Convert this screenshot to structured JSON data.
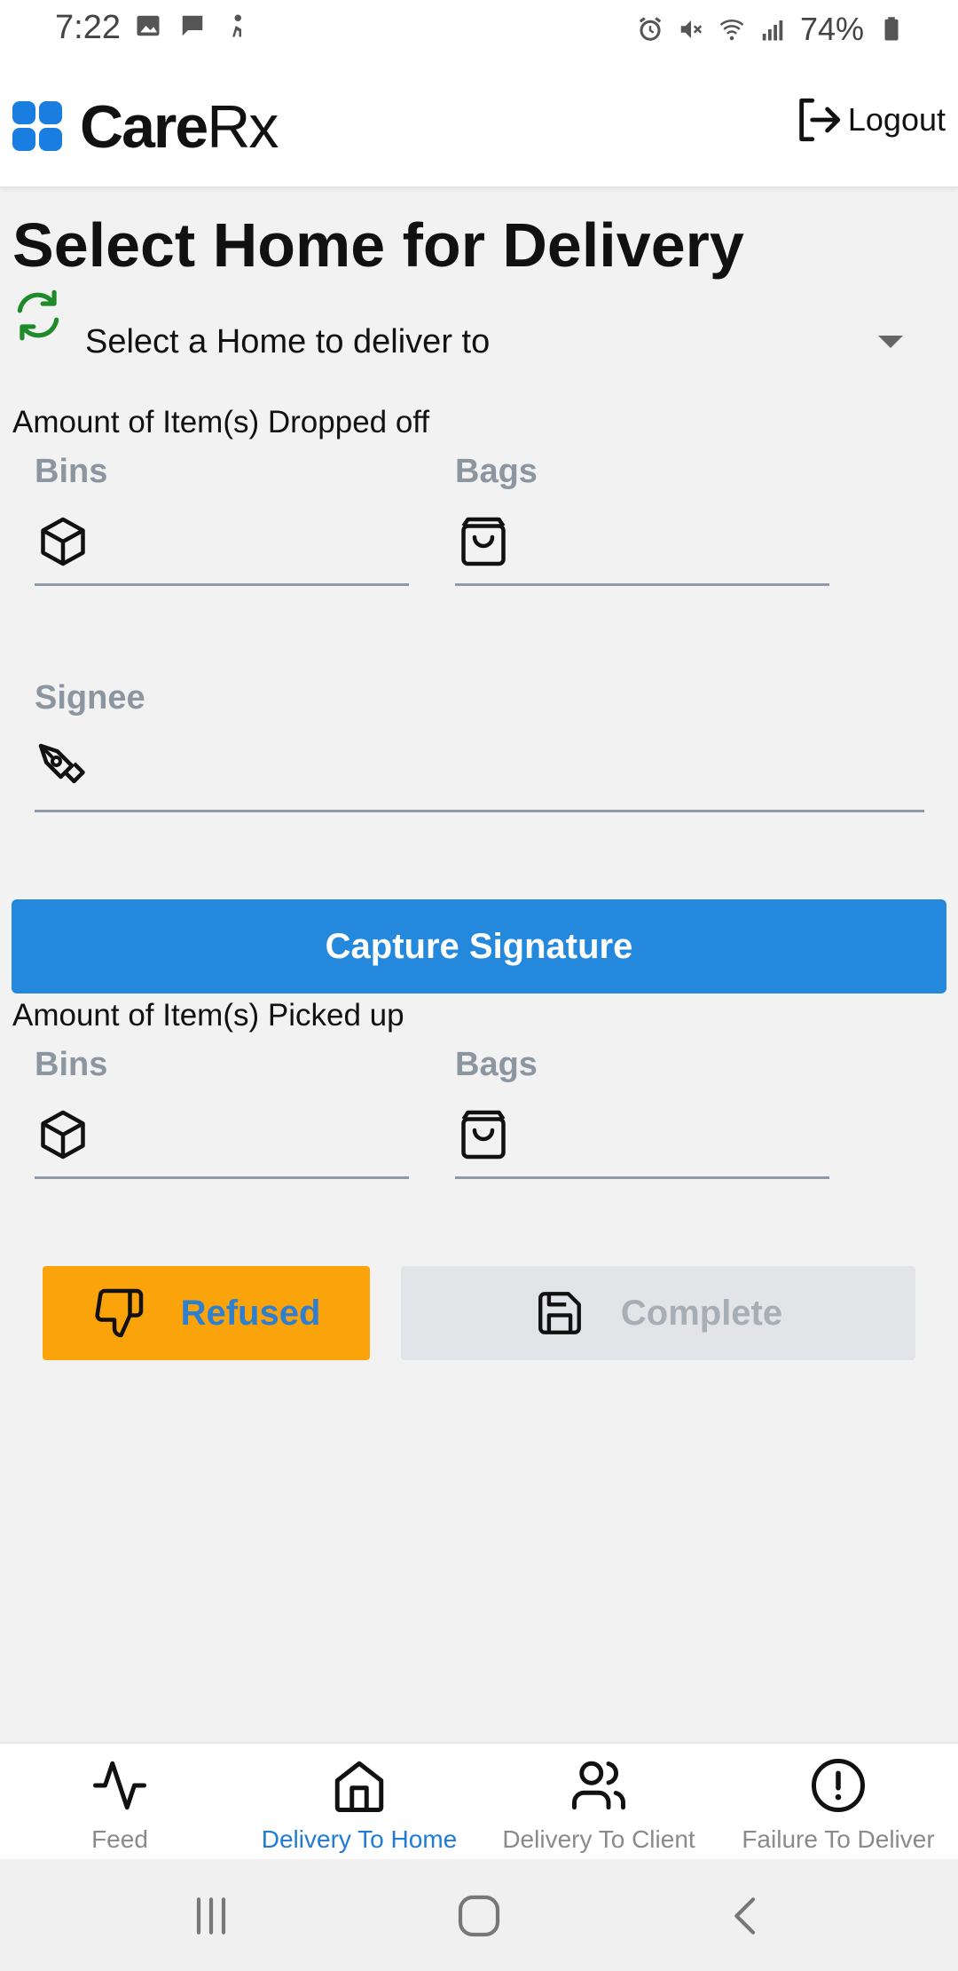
{
  "status_bar": {
    "time": "7:22",
    "battery": "74%"
  },
  "header": {
    "logo_text_bold": "Care",
    "logo_text_rest": "Rx",
    "logout_label": "Logout"
  },
  "page": {
    "title": "Select Home for Delivery",
    "home_select_value": "Select a Home to deliver to",
    "dropped_off_label": "Amount of Item(s) Dropped off",
    "picked_up_label": "Amount of Item(s) Picked up",
    "bins_label": "Bins",
    "bags_label": "Bags",
    "signee_label": "Signee",
    "capture_signature_label": "Capture Signature",
    "refused_label": "Refused",
    "complete_label": "Complete"
  },
  "bottom_nav": {
    "items": [
      {
        "label": "Feed",
        "icon": "activity-icon",
        "active": false
      },
      {
        "label": "Delivery To Home",
        "icon": "home-icon",
        "active": true
      },
      {
        "label": "Delivery To Client",
        "icon": "users-icon",
        "active": false
      },
      {
        "label": "Failure To Deliver",
        "icon": "alert-circle-icon",
        "active": false
      }
    ]
  },
  "colors": {
    "primary": "#2489dd",
    "refused": "#fba30a",
    "complete_disabled": "#e2e4e7",
    "active_nav": "#1f7bd6",
    "refresh_green": "#1e8a2a"
  }
}
